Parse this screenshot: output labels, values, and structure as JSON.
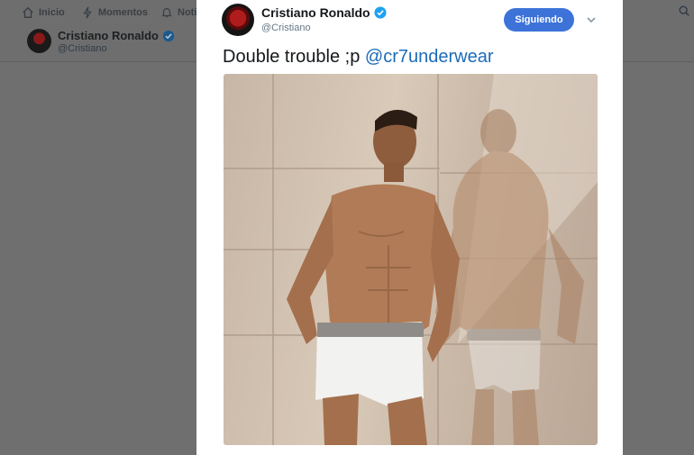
{
  "nav": {
    "home_label": "Inicio",
    "moments_label": "Momentos",
    "notifications_label": "Notif"
  },
  "profile_bar": {
    "name": "Cristiano Ronaldo",
    "handle": "@Cristiano"
  },
  "tweet": {
    "author_name": "Cristiano Ronaldo",
    "author_handle": "@Cristiano",
    "follow_button_label": "Siguiendo",
    "text": "Double trouble ;p ",
    "mention": "@cr7underwear",
    "image_alt": "Man in white underwear leaning against a mirrored stone wall"
  },
  "colors": {
    "accent": "#3d73d9",
    "link": "#1b6bb8",
    "verified": "#1da1f2",
    "overlay": "#6f6f6f"
  }
}
